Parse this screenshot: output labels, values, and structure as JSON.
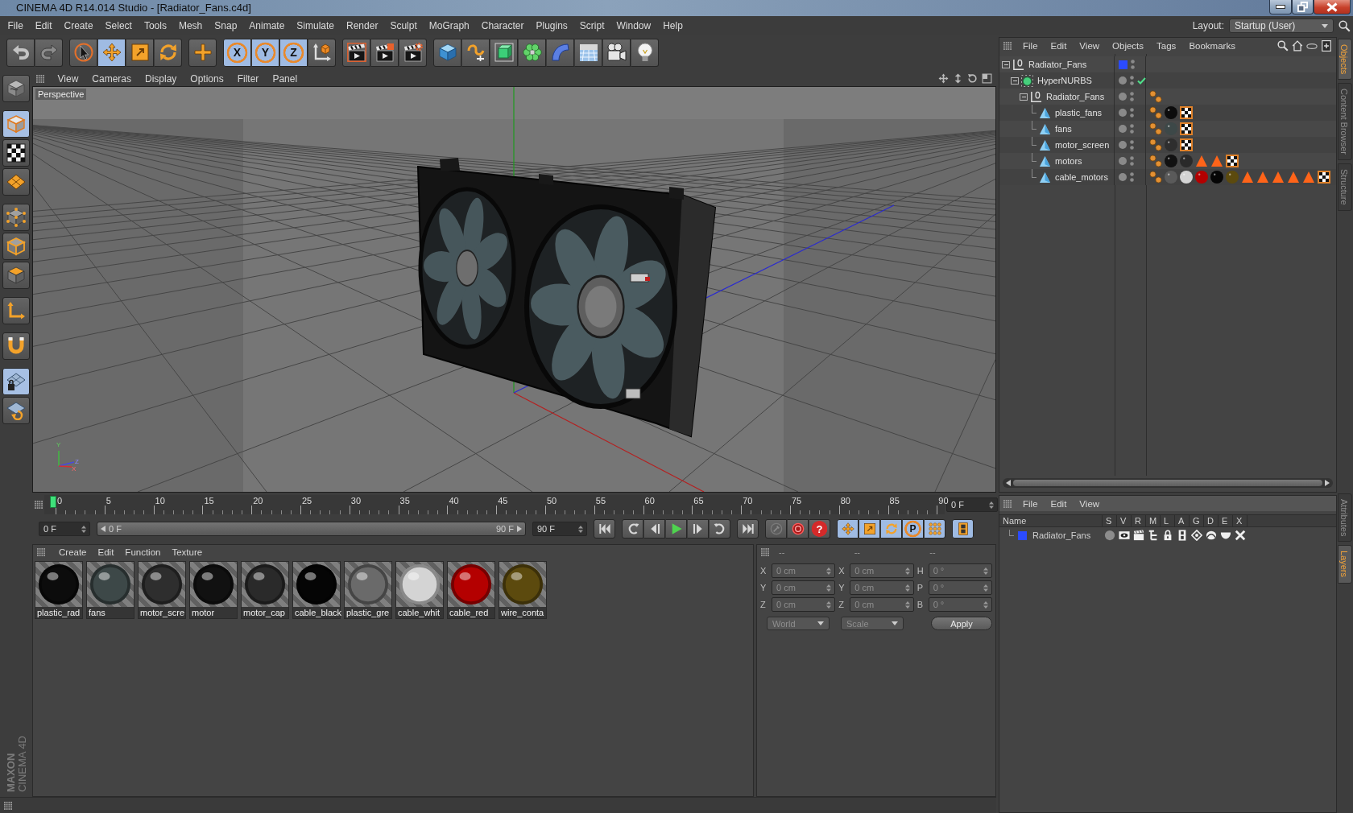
{
  "window": {
    "title": "CINEMA 4D R14.014 Studio - [Radiator_Fans.c4d]"
  },
  "menu_bar": {
    "items": [
      "File",
      "Edit",
      "Create",
      "Select",
      "Tools",
      "Mesh",
      "Snap",
      "Animate",
      "Simulate",
      "Render",
      "Sculpt",
      "MoGraph",
      "Character",
      "Plugins",
      "Script",
      "Window",
      "Help"
    ],
    "layout_label": "Layout:",
    "layout_value": "Startup (User)"
  },
  "toolbar": [
    [
      {
        "kind": "undo",
        "selected": false
      },
      {
        "kind": "redo",
        "selected": false
      }
    ],
    [
      {
        "kind": "live-selection",
        "selected": false
      },
      {
        "kind": "move",
        "selected": true
      },
      {
        "kind": "scale",
        "selected": false
      },
      {
        "kind": "rotate",
        "selected": false
      }
    ],
    [
      {
        "kind": "add",
        "selected": false
      }
    ],
    [
      {
        "kind": "axis-lock",
        "glyph": "X",
        "selected": true
      },
      {
        "kind": "axis-lock",
        "glyph": "Y",
        "selected": true
      },
      {
        "kind": "axis-lock",
        "glyph": "Z",
        "selected": true
      },
      {
        "kind": "coordinate-system",
        "selected": false
      }
    ],
    [
      {
        "kind": "render-view",
        "selected": false
      },
      {
        "kind": "render-picture-viewer",
        "selected": false
      },
      {
        "kind": "render-settings",
        "selected": false
      }
    ],
    [
      {
        "kind": "cube",
        "selected": false
      },
      {
        "kind": "spline-pen",
        "selected": false
      },
      {
        "kind": "subdivision-surface",
        "selected": false
      },
      {
        "kind": "cloner",
        "selected": false
      },
      {
        "kind": "bend",
        "selected": false
      },
      {
        "kind": "floor",
        "selected": false
      },
      {
        "kind": "camera",
        "selected": false
      },
      {
        "kind": "light",
        "selected": false
      }
    ]
  ],
  "mode_toolbar": [
    [
      {
        "kind": "make-editable",
        "selected": false
      }
    ],
    [
      {
        "kind": "model",
        "selected": true
      },
      {
        "kind": "texture",
        "selected": false
      },
      {
        "kind": "workplane",
        "selected": false
      }
    ],
    [
      {
        "kind": "points",
        "selected": false
      },
      {
        "kind": "edges",
        "selected": false
      },
      {
        "kind": "polygons",
        "selected": false
      }
    ],
    [
      {
        "kind": "axis",
        "selected": false
      }
    ],
    [
      {
        "kind": "snap",
        "selected": false
      }
    ],
    [
      {
        "kind": "locked-workplane",
        "selected": true
      },
      {
        "kind": "planar-workplane",
        "selected": false
      }
    ]
  ],
  "logo": {
    "brand": "MAXON",
    "product": "CINEMA 4D"
  },
  "viewport": {
    "menu": [
      "View",
      "Cameras",
      "Display",
      "Options",
      "Filter",
      "Panel"
    ],
    "camera": "Perspective",
    "axis_labels": [
      "Y",
      "Z",
      "X"
    ]
  },
  "timeline": {
    "ticks": [
      "0",
      "5",
      "10",
      "15",
      "20",
      "25",
      "30",
      "35",
      "40",
      "45",
      "50",
      "55",
      "60",
      "65",
      "70",
      "75",
      "80",
      "85",
      "90"
    ],
    "playhead": {
      "level": 0
    },
    "current_frame": "0 F",
    "start_frame": "0 F",
    "range": {
      "start": "0 F",
      "end": "90 F"
    },
    "end_frame": "90 F",
    "transport": [
      [
        {
          "kind": "go-to-start",
          "selected": false
        }
      ],
      [
        {
          "kind": "previous-key",
          "selected": false
        },
        {
          "kind": "previous-frame",
          "selected": false
        },
        {
          "kind": "play",
          "selected": false
        },
        {
          "kind": "next-frame",
          "selected": false
        },
        {
          "kind": "next-key",
          "selected": false
        }
      ],
      [
        {
          "kind": "go-to-end",
          "selected": false
        }
      ],
      [
        {
          "kind": "record",
          "selected": false
        },
        {
          "kind": "auto-key",
          "selected": false
        },
        {
          "kind": "keyframe-selection",
          "glyph": "?",
          "selected": false
        }
      ],
      [
        {
          "kind": "move",
          "selected": true
        },
        {
          "kind": "scale",
          "selected": true
        },
        {
          "kind": "rotate",
          "selected": true
        },
        {
          "kind": "parameter",
          "glyph": "P",
          "selected": true
        },
        {
          "kind": "point-level",
          "selected": true
        }
      ],
      [
        {
          "kind": "dope-sheet",
          "selected": true
        }
      ]
    ]
  },
  "material_manager": {
    "menu": [
      "Create",
      "Edit",
      "Function",
      "Texture"
    ],
    "materials": [
      {
        "name": "plastic_rad",
        "color": "#0c0c0c",
        "selected": false
      },
      {
        "name": "fans",
        "color": "#3d4848",
        "selected": false
      },
      {
        "name": "motor_scre",
        "color": "#2e2e2e",
        "selected": false
      },
      {
        "name": "motor",
        "color": "#111111",
        "selected": false
      },
      {
        "name": "motor_cap",
        "color": "#2a2a2a",
        "selected": false
      },
      {
        "name": "cable_black",
        "color": "#050505",
        "selected": false
      },
      {
        "name": "plastic_gre",
        "color": "#6a6a6a",
        "selected": false
      },
      {
        "name": "cable_whit",
        "color": "#d4d4d4",
        "selected": false
      },
      {
        "name": "cable_red",
        "color": "#b40000",
        "selected": false
      },
      {
        "name": "wire_conta",
        "color": "#5c4a0e",
        "selected": false
      }
    ]
  },
  "coordinates": {
    "headings": [
      "--",
      "--",
      "--"
    ],
    "rows": [
      [
        {
          "axis": "X",
          "value": "0 cm"
        },
        {
          "axis": "X",
          "value": "0 cm"
        },
        {
          "axis": "H",
          "value": "0 °"
        }
      ],
      [
        {
          "axis": "Y",
          "value": "0 cm"
        },
        {
          "axis": "Y",
          "value": "0 cm"
        },
        {
          "axis": "P",
          "value": "0 °"
        }
      ],
      [
        {
          "axis": "Z",
          "value": "0 cm"
        },
        {
          "axis": "Z",
          "value": "0 cm"
        },
        {
          "axis": "B",
          "value": "0 °"
        }
      ]
    ],
    "mode": "World",
    "transform": "Scale",
    "apply": "Apply"
  },
  "object_manager": {
    "menu": [
      "File",
      "Edit",
      "View",
      "Objects",
      "Tags",
      "Bookmarks"
    ],
    "objects": [
      {
        "name": "Radiator_Fans",
        "kind": "null",
        "selected": false,
        "expanded": true,
        "color": "#2b4bff",
        "children": [
          {
            "name": "HyperNURBS",
            "kind": "hypernurbs",
            "selected": false,
            "expanded": true,
            "enabled": true,
            "children": [
              {
                "name": "Radiator_Fans",
                "kind": "null",
                "selected": false,
                "expanded": true,
                "tags": [
                  {
                    "kind": "phong"
                  }
                ],
                "children": [
                  {
                    "name": "plastic_fans",
                    "kind": "polygon",
                    "selected": false,
                    "tags": [
                      {
                        "kind": "phong"
                      },
                      {
                        "kind": "material",
                        "color": "#0c0c0c"
                      },
                      {
                        "kind": "uvw"
                      }
                    ]
                  },
                  {
                    "name": "fans",
                    "kind": "polygon",
                    "selected": false,
                    "tags": [
                      {
                        "kind": "phong"
                      },
                      {
                        "kind": "material",
                        "color": "#3d4848"
                      },
                      {
                        "kind": "uvw"
                      }
                    ]
                  },
                  {
                    "name": "motor_screen",
                    "kind": "polygon",
                    "selected": false,
                    "tags": [
                      {
                        "kind": "phong"
                      },
                      {
                        "kind": "material",
                        "color": "#2e2e2e"
                      },
                      {
                        "kind": "uvw"
                      }
                    ]
                  },
                  {
                    "name": "motors",
                    "kind": "polygon",
                    "selected": false,
                    "tags": [
                      {
                        "kind": "phong"
                      },
                      {
                        "kind": "material",
                        "color": "#111111"
                      },
                      {
                        "kind": "material",
                        "color": "#2a2a2a"
                      },
                      {
                        "kind": "selection"
                      },
                      {
                        "kind": "selection"
                      },
                      {
                        "kind": "uvw"
                      }
                    ]
                  },
                  {
                    "name": "cable_motors",
                    "kind": "polygon",
                    "selected": false,
                    "tags": [
                      {
                        "kind": "phong"
                      },
                      {
                        "kind": "material",
                        "color": "#5a5a5a"
                      },
                      {
                        "kind": "material",
                        "color": "#d4d4d4"
                      },
                      {
                        "kind": "material",
                        "color": "#b40000"
                      },
                      {
                        "kind": "material",
                        "color": "#050505"
                      },
                      {
                        "kind": "material",
                        "color": "#5c4a0e"
                      },
                      {
                        "kind": "selection"
                      },
                      {
                        "kind": "selection"
                      },
                      {
                        "kind": "selection"
                      },
                      {
                        "kind": "selection"
                      },
                      {
                        "kind": "selection"
                      },
                      {
                        "kind": "uvw"
                      }
                    ]
                  }
                ]
              }
            ]
          }
        ]
      }
    ]
  },
  "layer_manager": {
    "menu": [
      "File",
      "Edit",
      "View"
    ],
    "columns": [
      "Name",
      "S",
      "V",
      "R",
      "M",
      "L",
      "A",
      "G",
      "D",
      "E",
      "X"
    ],
    "layers": [
      {
        "name": "Radiator_Fans",
        "color": "#2b4bff",
        "selected": false,
        "switches": [
          {
            "kind": "solo",
            "on": false
          },
          {
            "kind": "view",
            "on": true
          },
          {
            "kind": "render",
            "on": true
          },
          {
            "kind": "manager",
            "on": true
          },
          {
            "kind": "lock",
            "on": true
          },
          {
            "kind": "animation",
            "on": true
          },
          {
            "kind": "generators",
            "on": true
          },
          {
            "kind": "deformers",
            "on": true
          },
          {
            "kind": "expressions",
            "on": true
          },
          {
            "kind": "xref",
            "on": true
          }
        ]
      }
    ]
  },
  "side_tabs": {
    "top": [
      {
        "label": "Objects",
        "selected": true
      },
      {
        "label": "Content Browser",
        "selected": false
      },
      {
        "label": "Structure",
        "selected": false
      }
    ],
    "bottom": [
      {
        "label": "Attributes",
        "selected": false
      },
      {
        "label": "Layers",
        "selected": true
      }
    ]
  }
}
